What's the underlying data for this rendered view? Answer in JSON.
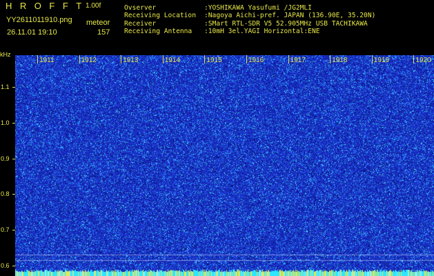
{
  "header": {
    "app_title": "HROFFT",
    "version": "1.00f",
    "file_name": "YY2611011910.png",
    "datetime": "26.11.01 19:10",
    "meteor_label": "meteor",
    "meteor_count": "157"
  },
  "info": [
    {
      "label": "Ovserver",
      "value": ":YOSHIKAWA Yasufumi /JG2MLI"
    },
    {
      "label": "Receiving Location",
      "value": ":Nagoya Aichi-pref. JAPAN (136.90E, 35.20N)"
    },
    {
      "label": "Receiver",
      "value": ":SMart RTL-SDR V5 52.905MHz USB TACHIKAWA"
    },
    {
      "label": "Receiving Antenna",
      "value": ":10mH 3el.YAGI Horizontal:ENE"
    }
  ],
  "axis": {
    "unit": "kHz",
    "ticks": [
      {
        "label": "1.1",
        "value": 1.1
      },
      {
        "label": "1.0",
        "value": 1.0
      },
      {
        "label": "0.9",
        "value": 0.9
      },
      {
        "label": "0.8",
        "value": 0.8
      },
      {
        "label": "0.7",
        "value": 0.7
      },
      {
        "label": "0.6",
        "value": 0.6
      }
    ],
    "freq_range_khz": [
      0.57,
      1.19
    ]
  },
  "time_labels": [
    "1911",
    "1912",
    "1913",
    "1914",
    "1915",
    "1916",
    "1917",
    "1918",
    "1919",
    "1920"
  ],
  "colors": {
    "text": "#e8e84a",
    "background": "#000000",
    "noise_base": "#1a2fd0",
    "noise_bright": "#30e0ff",
    "baseline": "#2ee6ff",
    "baseline_alt": "#e8e84a"
  }
}
